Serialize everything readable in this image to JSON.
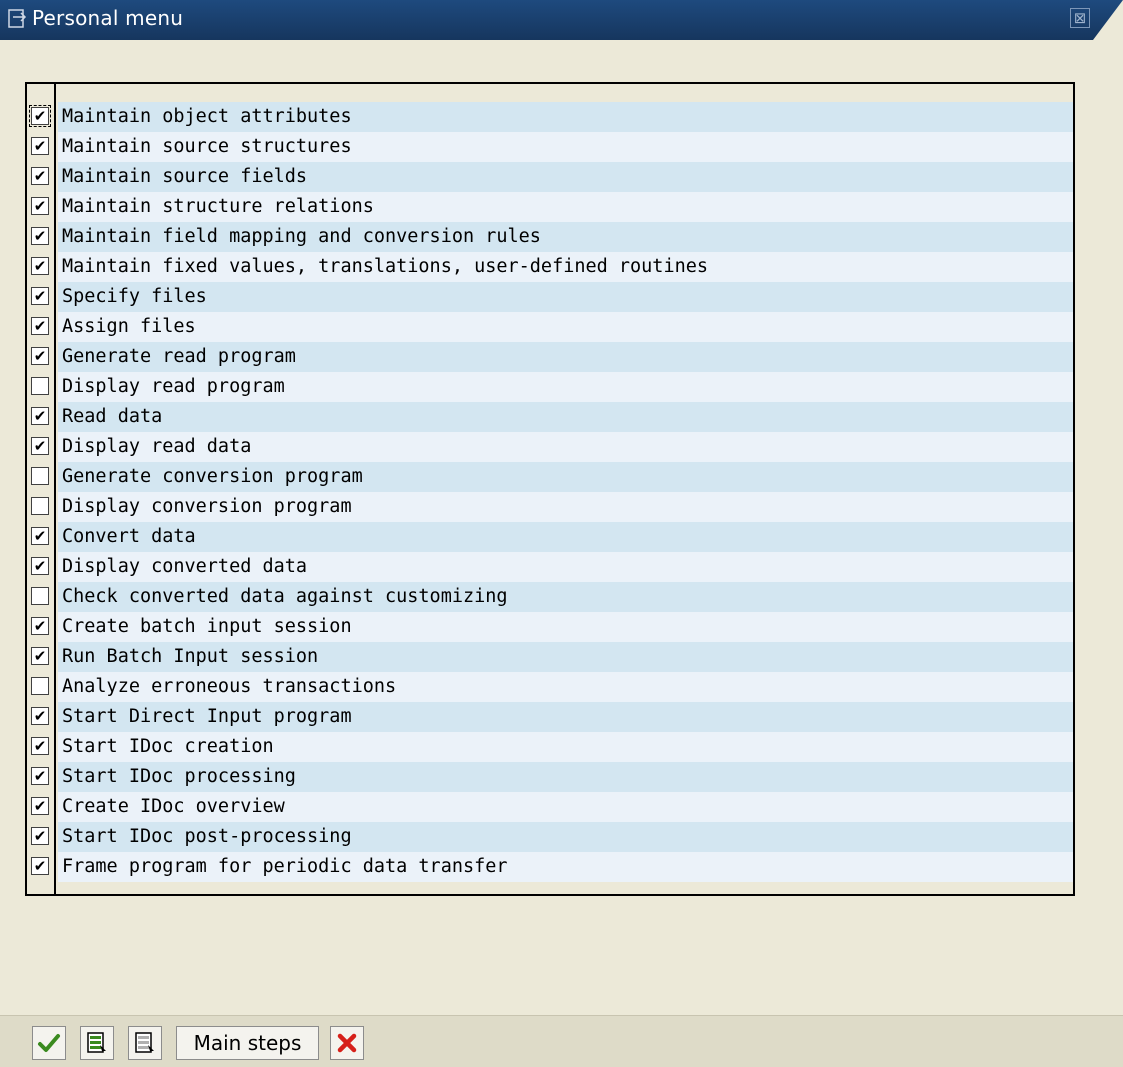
{
  "window": {
    "title": "Personal menu"
  },
  "items": [
    {
      "label": "Maintain object attributes",
      "checked": true
    },
    {
      "label": "Maintain source structures",
      "checked": true
    },
    {
      "label": "Maintain source fields",
      "checked": true
    },
    {
      "label": "Maintain structure relations",
      "checked": true
    },
    {
      "label": "Maintain field mapping and conversion rules",
      "checked": true
    },
    {
      "label": "Maintain fixed values, translations, user-defined routines",
      "checked": true
    },
    {
      "label": "Specify files",
      "checked": true
    },
    {
      "label": "Assign files",
      "checked": true
    },
    {
      "label": "Generate read program",
      "checked": true
    },
    {
      "label": "Display read program",
      "checked": false
    },
    {
      "label": "Read data",
      "checked": true
    },
    {
      "label": "Display read data",
      "checked": true
    },
    {
      "label": "Generate conversion program",
      "checked": false
    },
    {
      "label": "Display conversion program",
      "checked": false
    },
    {
      "label": "Convert data",
      "checked": true
    },
    {
      "label": "Display converted data",
      "checked": true
    },
    {
      "label": "Check converted data against customizing",
      "checked": false
    },
    {
      "label": "Create batch input session",
      "checked": true
    },
    {
      "label": "Run Batch Input session",
      "checked": true
    },
    {
      "label": "Analyze erroneous transactions",
      "checked": false
    },
    {
      "label": "Start Direct Input program",
      "checked": true
    },
    {
      "label": "Start IDoc creation",
      "checked": true
    },
    {
      "label": "Start IDoc processing",
      "checked": true
    },
    {
      "label": "Create IDoc overview",
      "checked": true
    },
    {
      "label": "Start IDoc post-processing",
      "checked": true
    },
    {
      "label": "Frame program for periodic data transfer",
      "checked": true
    }
  ],
  "toolbar": {
    "main_steps_label": "Main steps"
  },
  "icons": {
    "title": "window-icon",
    "confirm": "checkmark-icon",
    "select_all": "select-all-icon",
    "deselect_all": "deselect-all-icon",
    "cancel": "cancel-x-icon"
  },
  "colors": {
    "title_bar": "#1e4a7e",
    "row_odd": "#d3e6f1",
    "row_even": "#ebf2f9",
    "confirm_green": "#3a8a1e",
    "cancel_red": "#d6201a"
  }
}
